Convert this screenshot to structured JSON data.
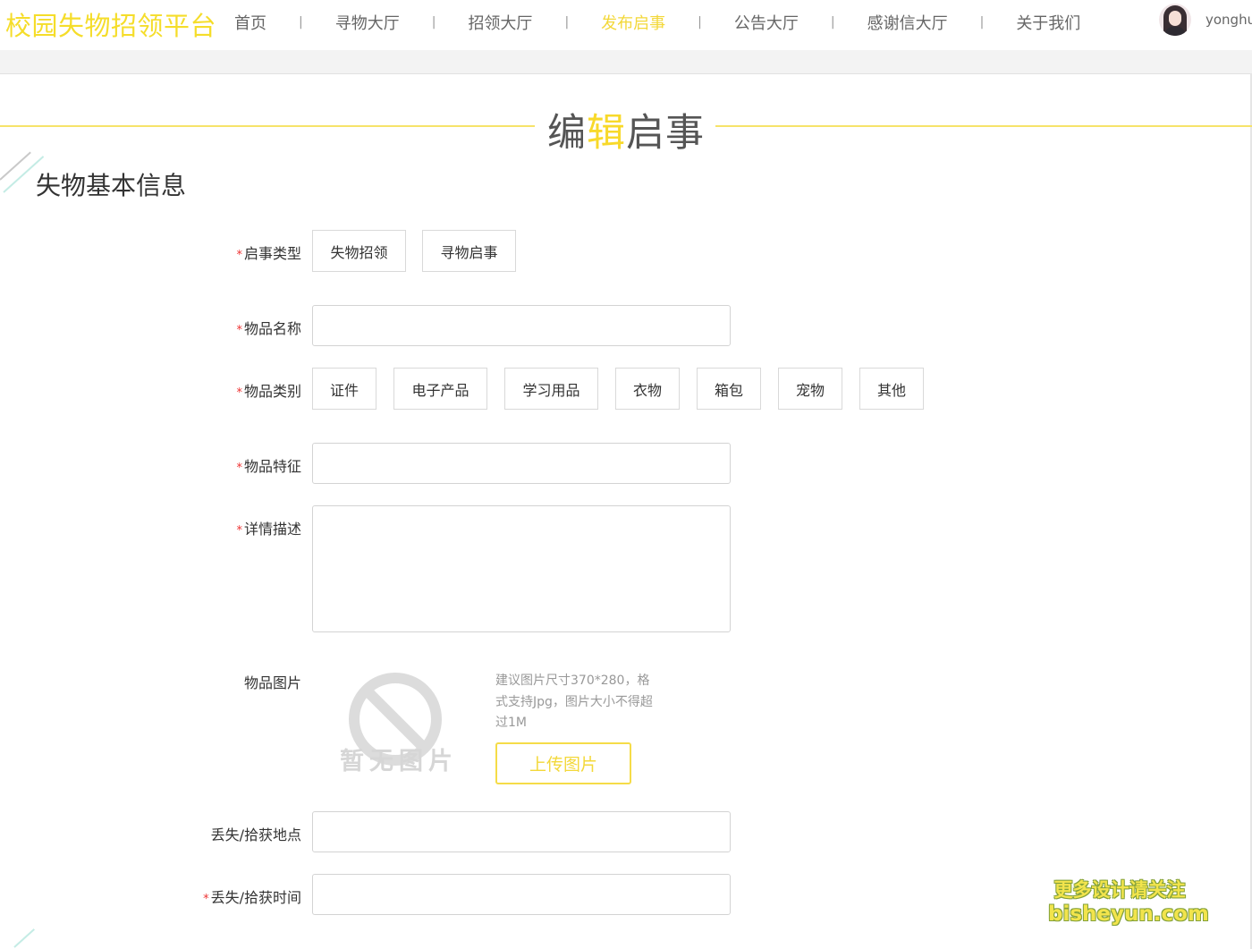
{
  "nav": {
    "brand": "校园失物招领平台",
    "menu": [
      "首页",
      "寻物大厅",
      "招领大厅",
      "发布启事",
      "公告大厅",
      "感谢信大厅",
      "关于我们"
    ],
    "separator": "|",
    "active_index": 3,
    "username": "yonghu"
  },
  "page": {
    "title_part1": "编",
    "title_highlight": "辑",
    "title_part2": "启事",
    "section_title": "失物基本信息"
  },
  "form": {
    "required_mark": "*",
    "notice_type": {
      "label": "启事类型",
      "options": [
        "失物招领",
        "寻物启事"
      ]
    },
    "item_name": {
      "label": "物品名称",
      "value": ""
    },
    "item_category": {
      "label": "物品类别",
      "options": [
        "证件",
        "电子产品",
        "学习用品",
        "衣物",
        "箱包",
        "宠物",
        "其他"
      ]
    },
    "item_feature": {
      "label": "物品特征",
      "value": ""
    },
    "description": {
      "label": "详情描述",
      "value": ""
    },
    "item_image": {
      "label": "物品图片",
      "placeholder_text": "暂无图片",
      "hint": "建议图片尺寸370*280，格式支持Jpg，图片大小不得超过1M",
      "upload_label": "上传图片"
    },
    "location": {
      "label": "丢失/拾获地点",
      "value": ""
    },
    "time": {
      "label": "丢失/拾获时间",
      "value": ""
    }
  },
  "watermark": {
    "line1": "更多设计请关注",
    "line2": "bisheyun.com"
  },
  "colors": {
    "accent": "#f5dd2a",
    "required": "#ee3333",
    "border": "#d9d9d9"
  }
}
